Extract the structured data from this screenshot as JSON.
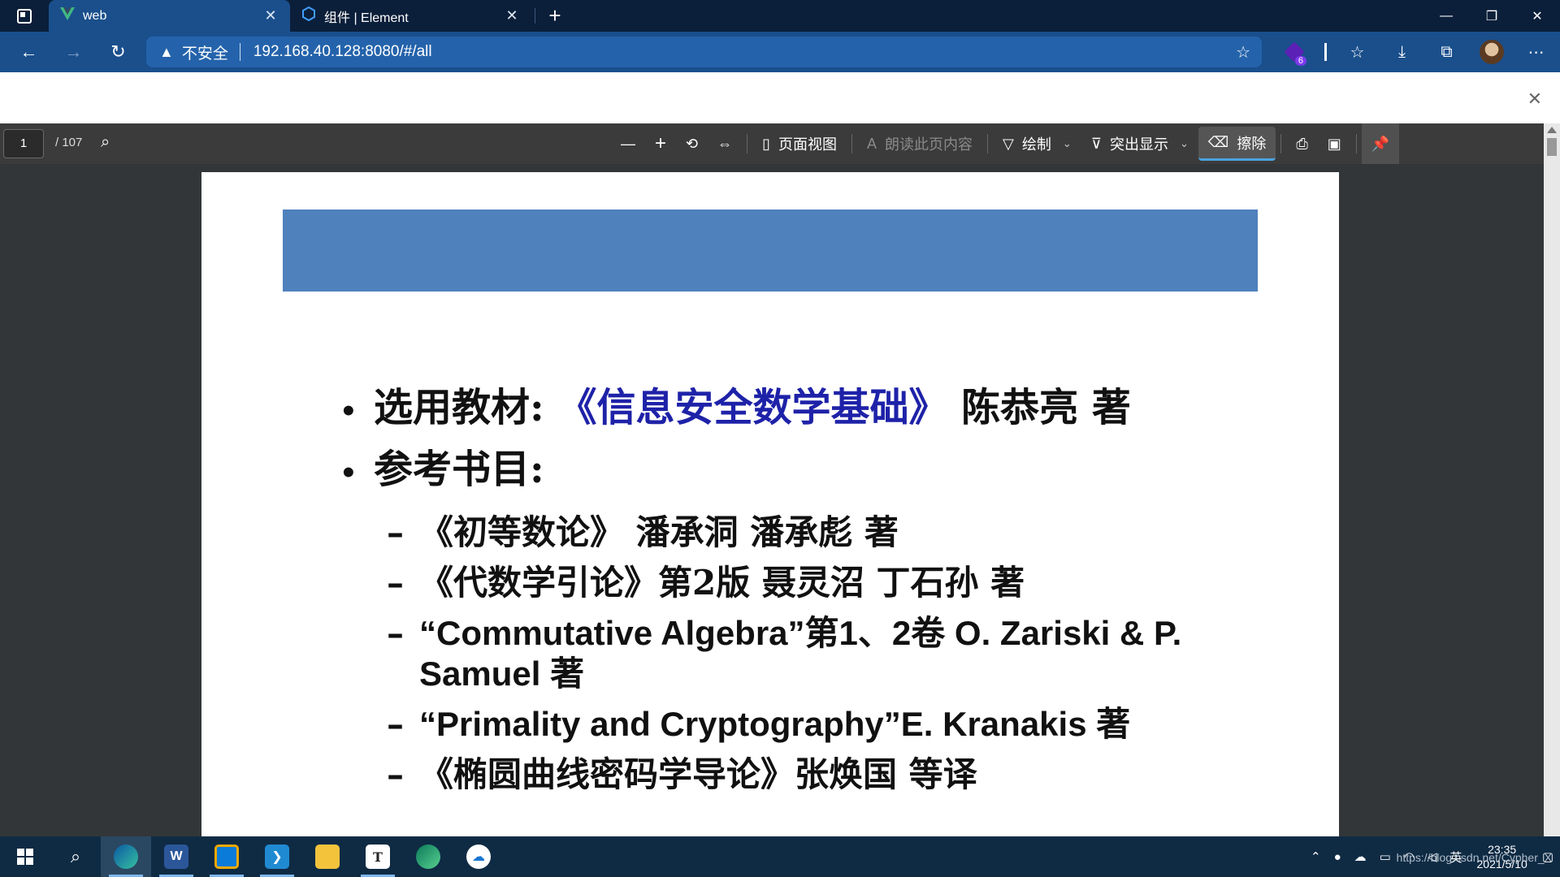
{
  "browser": {
    "tabs": [
      {
        "title": "web",
        "icon": "vue-logo-icon",
        "active": true
      },
      {
        "title": "组件 | Element",
        "icon": "element-logo-icon",
        "active": false
      }
    ],
    "new_tab_label": "+",
    "address": {
      "security_text": "不安全",
      "url": "192.168.40.128:8080/#/all"
    },
    "extension_badge": "6",
    "accent_color": "#1a4f8c"
  },
  "pdf_toolbar": {
    "page_current": "1",
    "page_total": "/ 107",
    "page_view_label": "页面视图",
    "read_aloud_label": "朗读此页内容",
    "draw_label": "绘制",
    "highlight_label": "突出显示",
    "erase_label": "擦除"
  },
  "slide": {
    "banner_color": "#4f81bd",
    "bullets": [
      {
        "prefix": "选用教材: ",
        "highlight": "《信息安全数学基础》",
        "suffix": " 陈恭亮 著"
      },
      {
        "prefix": "参考书目:",
        "highlight": "",
        "suffix": ""
      }
    ],
    "references": [
      "《初等数论》 潘承洞 潘承彪  著",
      "《代数学引论》第2版 聂灵沼 丁石孙 著",
      "“Commutative Algebra”第1、2卷 O. Zariski & P. Samuel 著",
      "“Primality and Cryptography”E. Kranakis 著",
      "《椭圆曲线密码学导论》张焕国 等译"
    ]
  },
  "taskbar": {
    "time": "23:35",
    "date": "2021/5/10",
    "ime": "英",
    "watermark": "https://blog.csdn.net/Cypher_X"
  }
}
